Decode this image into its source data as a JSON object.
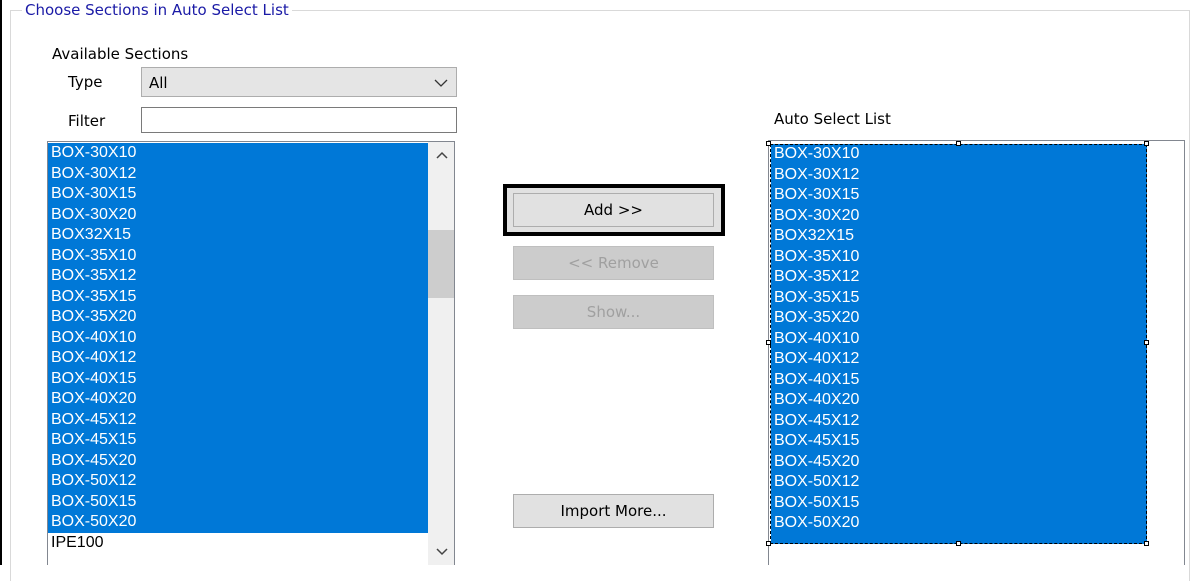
{
  "group": {
    "title": "Choose Sections in Auto Select List"
  },
  "available": {
    "heading": "Available Sections",
    "type_label": "Type",
    "type_value": "All",
    "filter_label": "Filter",
    "filter_value": "",
    "items": [
      {
        "label": "BOX-30X10",
        "selected": true
      },
      {
        "label": "BOX-30X12",
        "selected": true
      },
      {
        "label": "BOX-30X15",
        "selected": true
      },
      {
        "label": "BOX-30X20",
        "selected": true
      },
      {
        "label": "BOX32X15",
        "selected": true
      },
      {
        "label": "BOX-35X10",
        "selected": true
      },
      {
        "label": "BOX-35X12",
        "selected": true
      },
      {
        "label": "BOX-35X15",
        "selected": true
      },
      {
        "label": "BOX-35X20",
        "selected": true
      },
      {
        "label": "BOX-40X10",
        "selected": true
      },
      {
        "label": "BOX-40X12",
        "selected": true
      },
      {
        "label": "BOX-40X15",
        "selected": true
      },
      {
        "label": "BOX-40X20",
        "selected": true
      },
      {
        "label": "BOX-45X12",
        "selected": true
      },
      {
        "label": "BOX-45X15",
        "selected": true
      },
      {
        "label": "BOX-45X20",
        "selected": true
      },
      {
        "label": "BOX-50X12",
        "selected": true
      },
      {
        "label": "BOX-50X15",
        "selected": true
      },
      {
        "label": "BOX-50X20",
        "selected": true
      },
      {
        "label": "IPE100",
        "selected": false
      }
    ]
  },
  "buttons": {
    "add": "Add  >>",
    "remove": "<<  Remove",
    "show": "Show...",
    "import_more": "Import More..."
  },
  "auto_select": {
    "heading": "Auto Select List",
    "items": [
      "BOX-30X10",
      "BOX-30X12",
      "BOX-30X15",
      "BOX-30X20",
      "BOX32X15",
      "BOX-35X10",
      "BOX-35X12",
      "BOX-35X15",
      "BOX-35X20",
      "BOX-40X10",
      "BOX-40X12",
      "BOX-40X15",
      "BOX-40X20",
      "BOX-45X12",
      "BOX-45X15",
      "BOX-45X20",
      "BOX-50X12",
      "BOX-50X15",
      "BOX-50X20"
    ]
  },
  "colors": {
    "selection": "#0078d7",
    "group_title": "#1a1aa6"
  }
}
